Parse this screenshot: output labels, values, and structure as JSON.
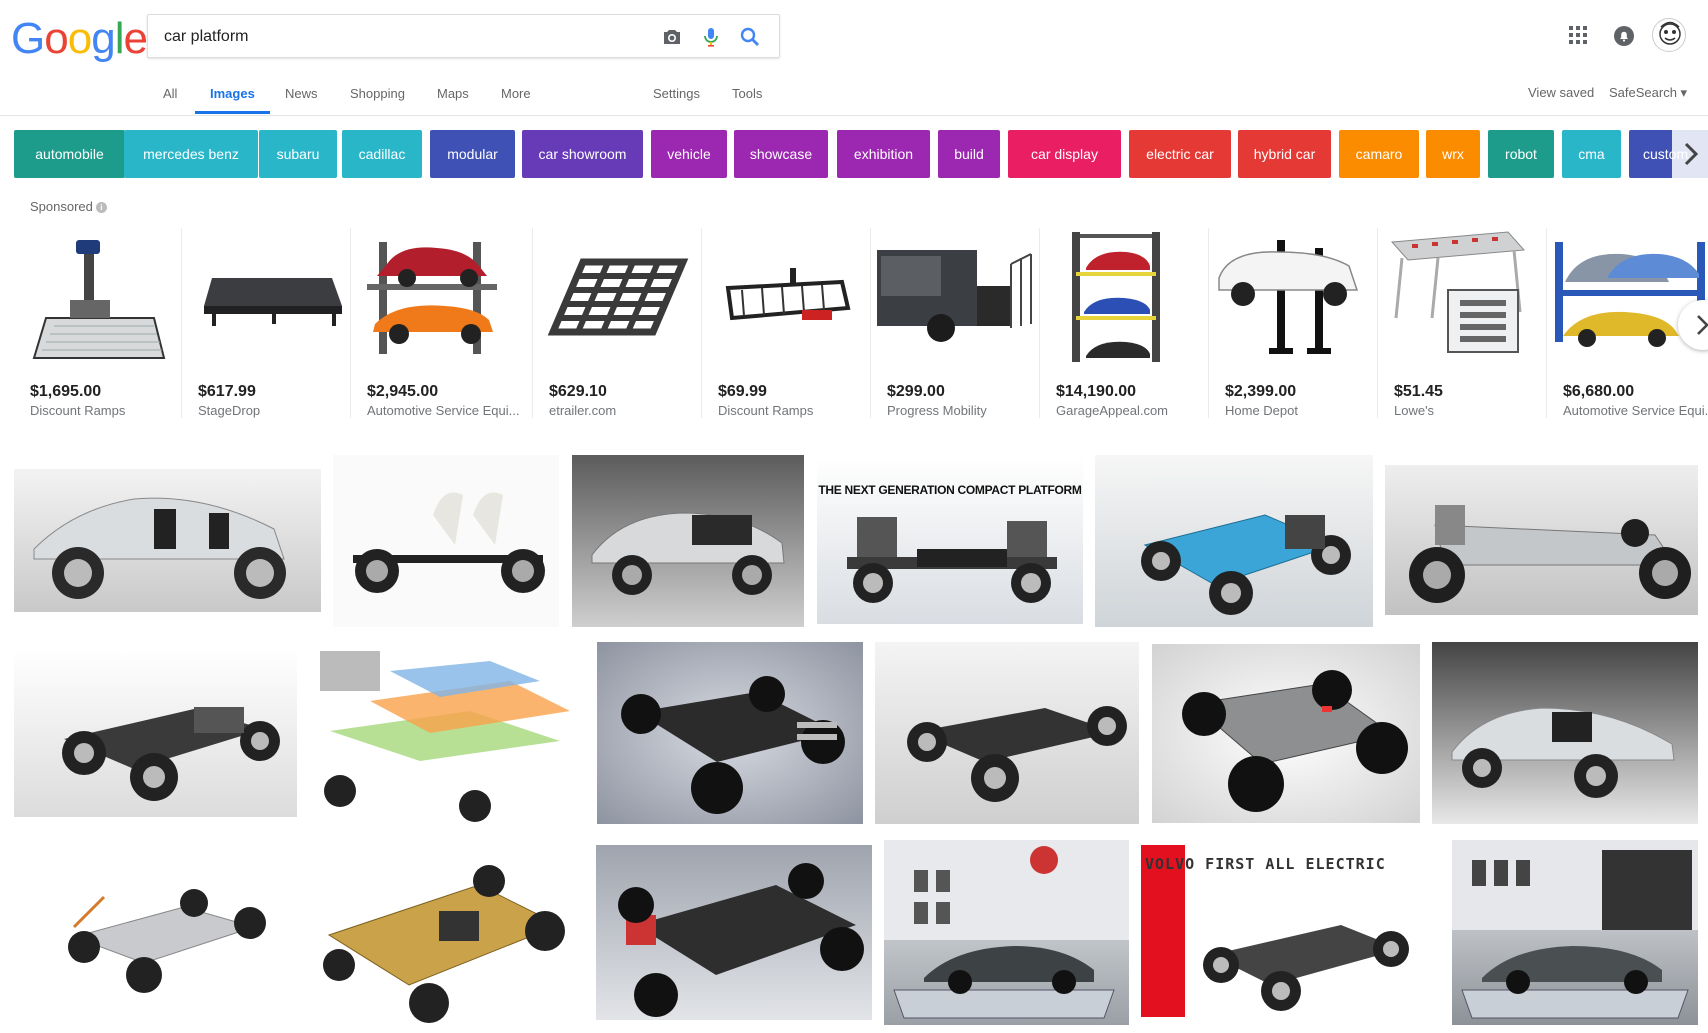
{
  "logo": {
    "letters": [
      "G",
      "o",
      "o",
      "g",
      "l",
      "e"
    ],
    "colors": [
      "#4285F4",
      "#EA4335",
      "#FBBC05",
      "#4285F4",
      "#34A853",
      "#EA4335"
    ]
  },
  "search": {
    "query": "car platform"
  },
  "nav": {
    "tabs": [
      {
        "label": "All"
      },
      {
        "label": "Images"
      },
      {
        "label": "News"
      },
      {
        "label": "Shopping"
      },
      {
        "label": "Maps"
      },
      {
        "label": "More"
      },
      {
        "label": "Settings"
      },
      {
        "label": "Tools"
      }
    ],
    "view_saved": "View saved",
    "safesearch": "SafeSearch ▾"
  },
  "chips": [
    {
      "label": "automobile",
      "color": "#1E9C8B"
    },
    {
      "label": "mercedes benz",
      "color": "#29B6C9"
    },
    {
      "label": "subaru",
      "color": "#29B6C9"
    },
    {
      "label": "cadillac",
      "color": "#29B6C9"
    },
    {
      "label": "modular",
      "color": "#3F51B5"
    },
    {
      "label": "car showroom",
      "color": "#673AB7"
    },
    {
      "label": "vehicle",
      "color": "#9C27B0"
    },
    {
      "label": "showcase",
      "color": "#9C27B0"
    },
    {
      "label": "exhibition",
      "color": "#9C27B0"
    },
    {
      "label": "build",
      "color": "#9C27B0"
    },
    {
      "label": "car display",
      "color": "#E91E63"
    },
    {
      "label": "electric car",
      "color": "#E53935"
    },
    {
      "label": "hybrid car",
      "color": "#E53935"
    },
    {
      "label": "camaro",
      "color": "#FB8C00"
    },
    {
      "label": "wrx",
      "color": "#FB8C00"
    },
    {
      "label": "robot",
      "color": "#1E9C8B"
    },
    {
      "label": "cma",
      "color": "#29B6C9"
    },
    {
      "label": "custom",
      "color": "#3F51B5"
    }
  ],
  "sponsored": {
    "label": "Sponsored",
    "products": [
      {
        "price": "$1,695.00",
        "seller": "Discount Ramps",
        "icon": "wheelchair-lift-platform"
      },
      {
        "price": "$617.99",
        "seller": "StageDrop",
        "icon": "stage-platform"
      },
      {
        "price": "$2,945.00",
        "seller": "Automotive Service Equi...",
        "icon": "car-storage-lift"
      },
      {
        "price": "$629.10",
        "seller": "etrailer.com",
        "icon": "roof-rack"
      },
      {
        "price": "$69.99",
        "seller": "Discount Ramps",
        "icon": "hitch-cargo-carrier"
      },
      {
        "price": "$299.00",
        "seller": "Progress Mobility",
        "icon": "truck-hitch-carrier"
      },
      {
        "price": "$14,190.00",
        "seller": "GarageAppeal.com",
        "icon": "stacker-lift"
      },
      {
        "price": "$2,399.00",
        "seller": "Home Depot",
        "icon": "two-post-lift"
      },
      {
        "price": "$51.45",
        "seller": "Lowe's",
        "icon": "work-platform"
      },
      {
        "price": "$6,680.00",
        "seller": "Automotive Service Equi...",
        "icon": "parking-lift"
      }
    ]
  },
  "results": [
    {
      "caption": ""
    },
    {
      "caption": ""
    },
    {
      "caption": ""
    },
    {
      "caption": "THE NEXT GENERATION COMPACT PLATFORM"
    },
    {
      "caption": ""
    },
    {
      "caption": ""
    },
    {
      "caption": ""
    },
    {
      "caption": ""
    },
    {
      "caption": ""
    },
    {
      "caption": ""
    },
    {
      "caption": ""
    },
    {
      "caption": ""
    },
    {
      "caption": ""
    },
    {
      "caption": ""
    },
    {
      "caption": ""
    },
    {
      "caption": ""
    },
    {
      "caption": "VOLVO FIRST ALL ELECTRIC"
    },
    {
      "caption": ""
    }
  ],
  "colors": {
    "accent": "#1a73e8",
    "muted": "#666666"
  }
}
